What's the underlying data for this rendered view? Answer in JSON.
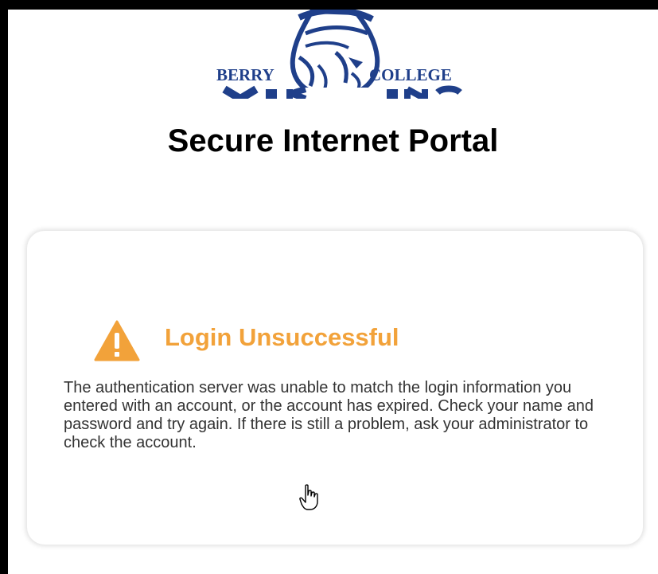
{
  "logo": {
    "left_word": "BERRY",
    "right_word": "COLLEGE",
    "wordmark": "VIKINGS",
    "color": "#1f3f8a"
  },
  "page": {
    "title": "Secure Internet Portal"
  },
  "alert": {
    "icon": "warning-triangle-icon",
    "icon_color": "#f2a23a",
    "heading": "Login Unsuccessful",
    "heading_color": "#f2a23a",
    "message": "The authentication server was unable to match the login information you entered with an account, or the account has expired. Check your name and password and try again. If there is still a problem, ask your administrator to check the account."
  },
  "cursor": {
    "icon": "hand-pointer-icon"
  }
}
